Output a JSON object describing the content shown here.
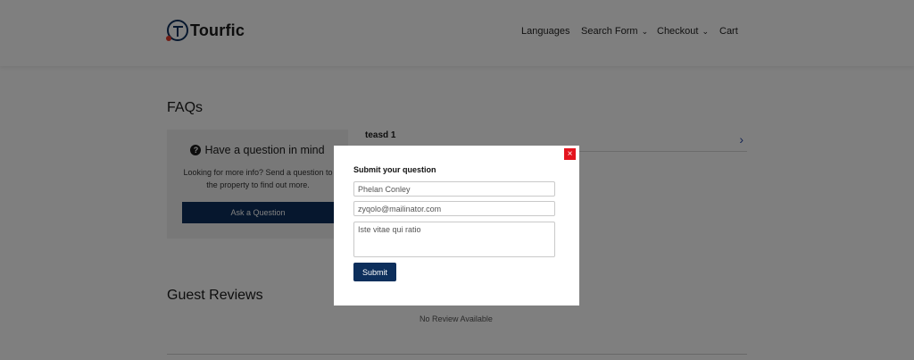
{
  "brand": {
    "name": "Tourfic"
  },
  "nav": {
    "languages": "Languages",
    "search_form": "Search Form",
    "checkout": "Checkout",
    "cart": "Cart"
  },
  "faqs": {
    "title": "FAQs",
    "ask_heading": "Have a question in mind",
    "ask_desc": "Looking for more info? Send a question to the property to find out more.",
    "ask_button": "Ask a Question",
    "items": [
      {
        "question": "teasd 1"
      }
    ]
  },
  "reviews": {
    "title": "Guest Reviews",
    "empty": "No Review Available"
  },
  "modal": {
    "close": "×",
    "title": "Submit your question",
    "name_value": "Phelan Conley",
    "email_value": "zyqolo@mailinator.com",
    "message_value": "Iste vitae qui ratio",
    "submit": "Submit"
  },
  "colors": {
    "primary": "#0d2f5c",
    "close": "#e4141e",
    "link_arrow": "#2c4ba8"
  }
}
